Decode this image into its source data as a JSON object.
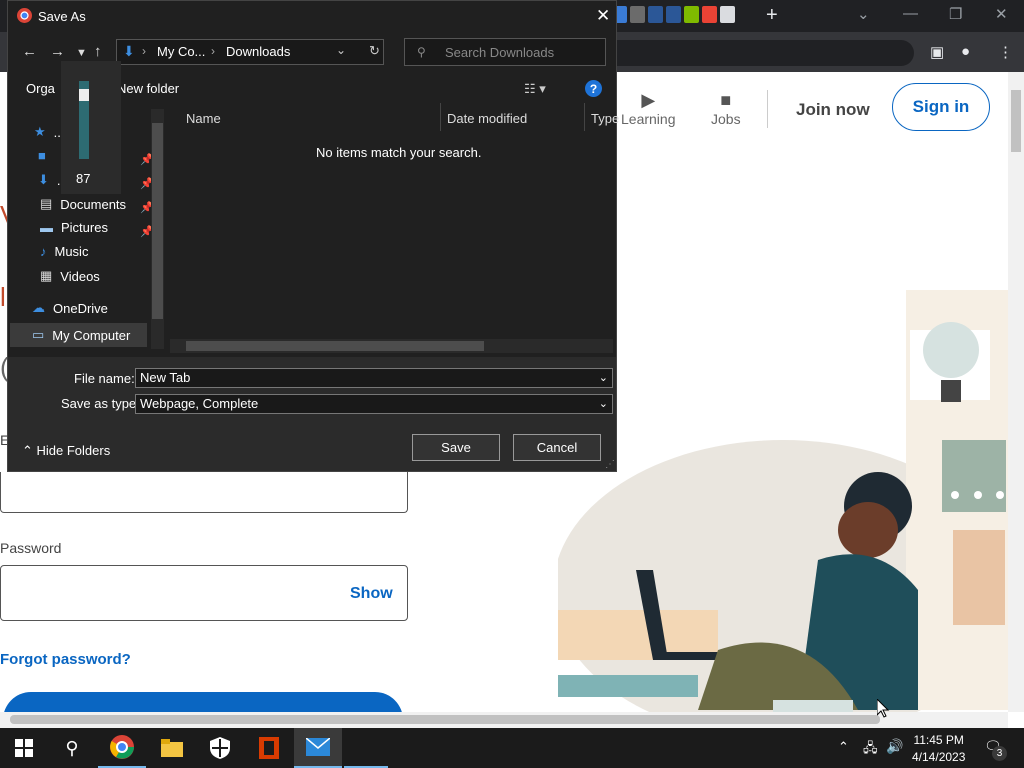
{
  "dialog": {
    "title": "Save As",
    "breadcrumb": [
      "My Co...",
      "Downloads"
    ],
    "search_placeholder": "Search Downloads",
    "organize_label": "Orga",
    "new_folder_label": "New folder",
    "popup_value": "87",
    "sidebar": [
      {
        "label": "...s",
        "icon": "star-icon"
      },
      {
        "label": "",
        "icon": "desktop-icon",
        "pinned": true
      },
      {
        "label": "...s",
        "icon": "download-icon",
        "pinned": true
      },
      {
        "label": "Documents",
        "icon": "documents-icon",
        "pinned": true
      },
      {
        "label": "Pictures",
        "icon": "pictures-icon",
        "pinned": true
      },
      {
        "label": "Music",
        "icon": "music-icon"
      },
      {
        "label": "Videos",
        "icon": "videos-icon"
      },
      {
        "label": "OneDrive",
        "icon": "onedrive-icon"
      },
      {
        "label": "My Computer",
        "icon": "computer-icon"
      }
    ],
    "columns": [
      "Name",
      "Date modified",
      "Type"
    ],
    "empty_message": "No items match your search.",
    "file_name_label": "File name:",
    "file_name_value": "New Tab",
    "save_type_label": "Save as type:",
    "save_type_value": "Webpage, Complete",
    "hide_folders_label": "Hide Folders",
    "save_button": "Save",
    "cancel_button": "Cancel"
  },
  "page": {
    "nav_learning": "Learning",
    "nav_jobs": "Jobs",
    "join_now": "Join now",
    "sign_in": "Sign in",
    "password_label": "Password",
    "show_label": "Show",
    "forgot_password": "Forgot password?",
    "email_label_fragment": "E"
  },
  "taskbar": {
    "time": "11:45 PM",
    "date": "4/14/2023",
    "notifications": "3"
  },
  "colors": {
    "accent": "#0a66c2",
    "dialog_bg": "#202020",
    "taskbar_bg": "#1b1b1b"
  }
}
